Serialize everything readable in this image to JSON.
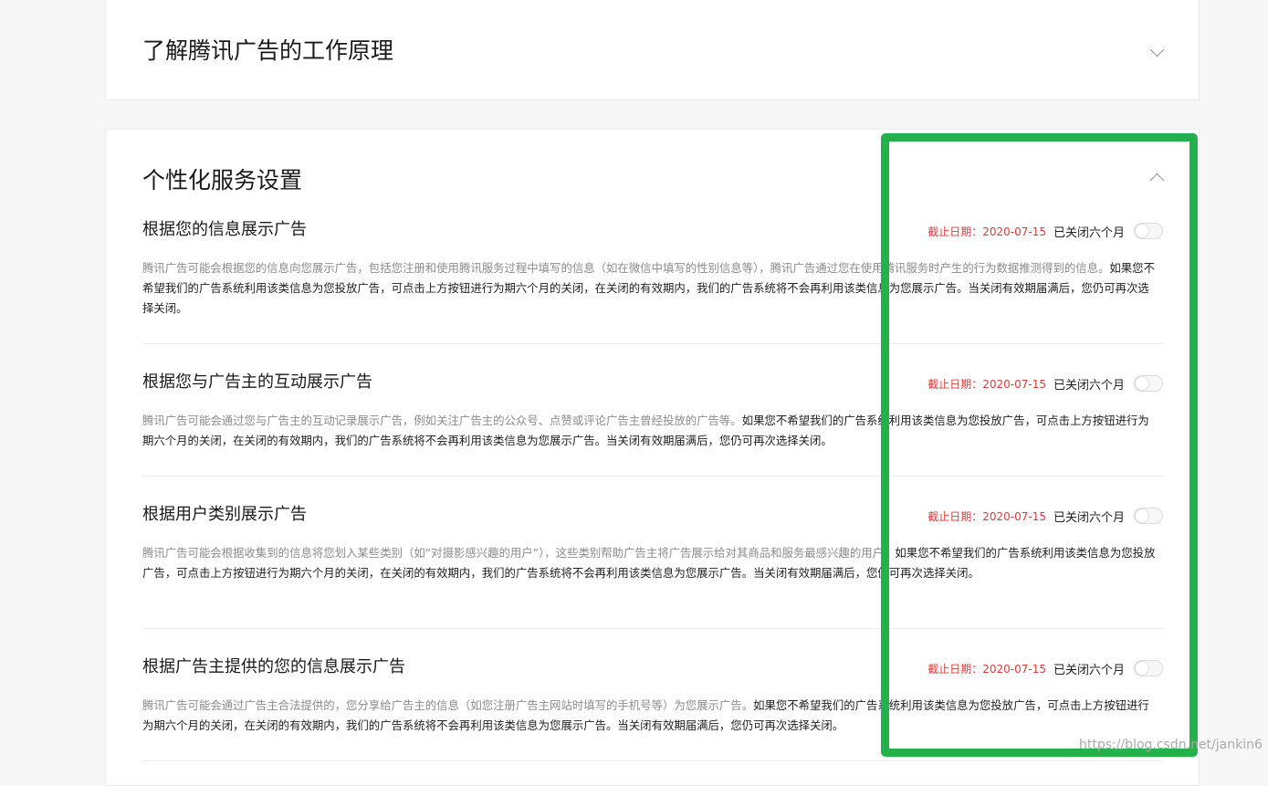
{
  "panel_top": {
    "title": "了解腾讯广告的工作原理"
  },
  "panel_main": {
    "title": "个性化服务设置",
    "sections": [
      {
        "title": "根据您的信息展示广告",
        "deadline": "截止日期：2020-07-15",
        "status": "已关闭六个月",
        "toggle_on": false,
        "desc_gray": "腾讯广告可能会根据您的信息向您展示广告，包括您注册和使用腾讯服务过程中填写的信息（如在微信中填写的性别信息等），腾讯广告通过您在使用腾讯服务时产生的行为数据推测得到的信息。",
        "desc_dark": "如果您不希望我们的广告系统利用该类信息为您投放广告，可点击上方按钮进行为期六个月的关闭，在关闭的有效期内，我们的广告系统将不会再利用该类信息为您展示广告。当关闭有效期届满后，您仍可再次选择关闭。"
      },
      {
        "title": "根据您与广告主的互动展示广告",
        "deadline": "截止日期：2020-07-15",
        "status": "已关闭六个月",
        "toggle_on": false,
        "desc_gray": "腾讯广告可能会通过您与广告主的互动记录展示广告，例如关注广告主的公众号、点赞或评论广告主曾经投放的广告等。",
        "desc_dark": "如果您不希望我们的广告系统利用该类信息为您投放广告，可点击上方按钮进行为期六个月的关闭，在关闭的有效期内，我们的广告系统将不会再利用该类信息为您展示广告。当关闭有效期届满后，您仍可再次选择关闭。"
      },
      {
        "title": "根据用户类别展示广告",
        "deadline": "截止日期：2020-07-15",
        "status": "已关闭六个月",
        "toggle_on": false,
        "desc_gray": "腾讯广告可能会根据收集到的信息将您划入某些类别（如“对摄影感兴趣的用户”），这些类别帮助广告主将广告展示给对其商品和服务最感兴趣的用户。",
        "desc_dark": "如果您不希望我们的广告系统利用该类信息为您投放广告，可点击上方按钮进行为期六个月的关闭，在关闭的有效期内，我们的广告系统将不会再利用该类信息为您展示广告。当关闭有效期届满后，您仍可再次选择关闭。"
      },
      {
        "title": "根据广告主提供的您的信息展示广告",
        "deadline": "截止日期：2020-07-15",
        "status": "已关闭六个月",
        "toggle_on": false,
        "desc_gray": "腾讯广告可能会通过广告主合法提供的，您分享给广告主的信息（如您注册广告主网站时填写的手机号等）为您展示广告。",
        "desc_dark": "如果您不希望我们的广告系统利用该类信息为您投放广告，可点击上方按钮进行为期六个月的关闭，在关闭的有效期内，我们的广告系统将不会再利用该类信息为您展示广告。当关闭有效期届满后，您仍可再次选择关闭。"
      }
    ]
  },
  "watermark": "https://blog.csdn.net/jankin6",
  "colors": {
    "deadline": "#e03a3a",
    "highlight_box": "#22b14c"
  },
  "icons": {
    "collapse_closed": "chevron-down-icon",
    "collapse_open": "chevron-up-icon"
  }
}
